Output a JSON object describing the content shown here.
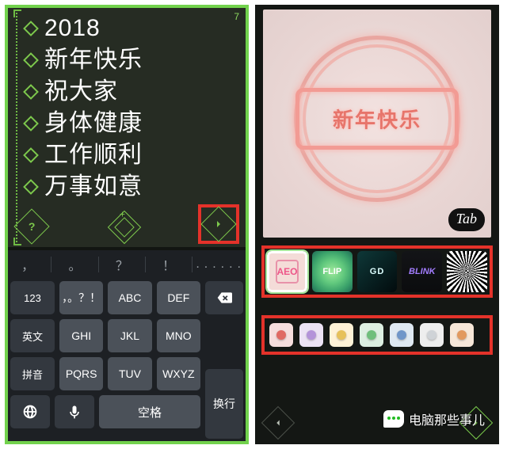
{
  "left": {
    "counter": "7",
    "lines": [
      "2018",
      "新年快乐",
      "祝大家",
      "身体健康",
      "工作顺利",
      "万事如意"
    ],
    "suggestions": [
      "，",
      "。",
      "？",
      "！",
      "......"
    ],
    "keys": {
      "r1": [
        "123",
        "，。？！",
        "ABC",
        "DEF"
      ],
      "r2": [
        "英文",
        "GHI",
        "JKL",
        "MNO"
      ],
      "r3": [
        "拼音",
        "PQRS",
        "TUV",
        "WXYZ"
      ],
      "space": "空格",
      "ret": "换行"
    },
    "help": "?"
  },
  "right": {
    "neon_text": "新年快乐",
    "tab": "Tab",
    "styles": [
      "AEO",
      "FLIP",
      "GD",
      "BLINK",
      ""
    ],
    "colors": [
      {
        "bg": "#f6dedd",
        "led": "#e06a63"
      },
      {
        "bg": "#ece2f4",
        "led": "#b493d9"
      },
      {
        "bg": "#fff2d6",
        "led": "#e7c15a"
      },
      {
        "bg": "#ddefe1",
        "led": "#6fbf7b"
      },
      {
        "bg": "#dfe9f2",
        "led": "#6f96c9"
      },
      {
        "bg": "#eeeeee",
        "led": "#cfd3d7"
      },
      {
        "bg": "#f7e7d8",
        "led": "#e2995e"
      }
    ]
  },
  "watermark": "电脑那些事儿"
}
